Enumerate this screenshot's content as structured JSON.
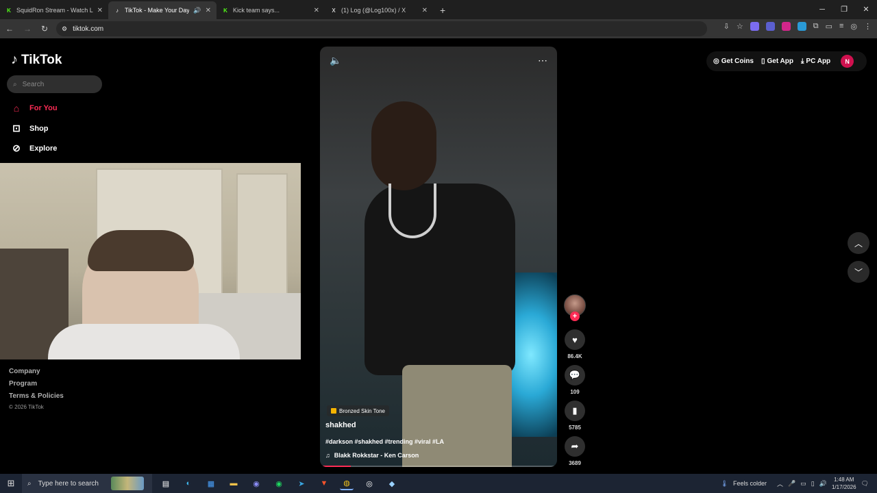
{
  "browser": {
    "tabs": [
      {
        "title": "SquidRon Stream - Watch Live",
        "fav": "K",
        "fav_color": "#53fc18"
      },
      {
        "title": "TikTok - Make Your Day",
        "fav": "♪",
        "fav_color": "#ffffff"
      },
      {
        "title": "Kick team says...",
        "fav": "K",
        "fav_color": "#53fc18"
      },
      {
        "title": "(1) Log (@Log100x) / X",
        "fav": "X",
        "fav_color": "#ffffff"
      }
    ],
    "url": "tiktok.com"
  },
  "sidebar": {
    "brand": "TikTok",
    "search_placeholder": "Search",
    "nav": [
      {
        "label": "For You"
      },
      {
        "label": "Shop"
      },
      {
        "label": "Explore"
      }
    ],
    "footer": [
      "Company",
      "Program",
      "Terms & Policies"
    ],
    "copyright": "© 2026 TikTok"
  },
  "video": {
    "tag": "Bronzed Skin Tone",
    "username": "shakhed",
    "caption": "#darkson #shakhed #trending #viral #LA",
    "music": "Blakk Rokkstar - Ken Carson",
    "progress": 0.13
  },
  "actions": {
    "likes": "86.4K",
    "comments": "109",
    "saves": "5785",
    "shares": "3689"
  },
  "topright": {
    "coins": "Get Coins",
    "app": "Get App",
    "pc": "PC App",
    "avatar_letter": "N"
  },
  "taskbar": {
    "search_placeholder": "Type here to search",
    "weather": "Feels colder",
    "time": "1:48 AM",
    "date": "1/17/2026"
  },
  "colors": {
    "accent": "#fe2c55"
  }
}
